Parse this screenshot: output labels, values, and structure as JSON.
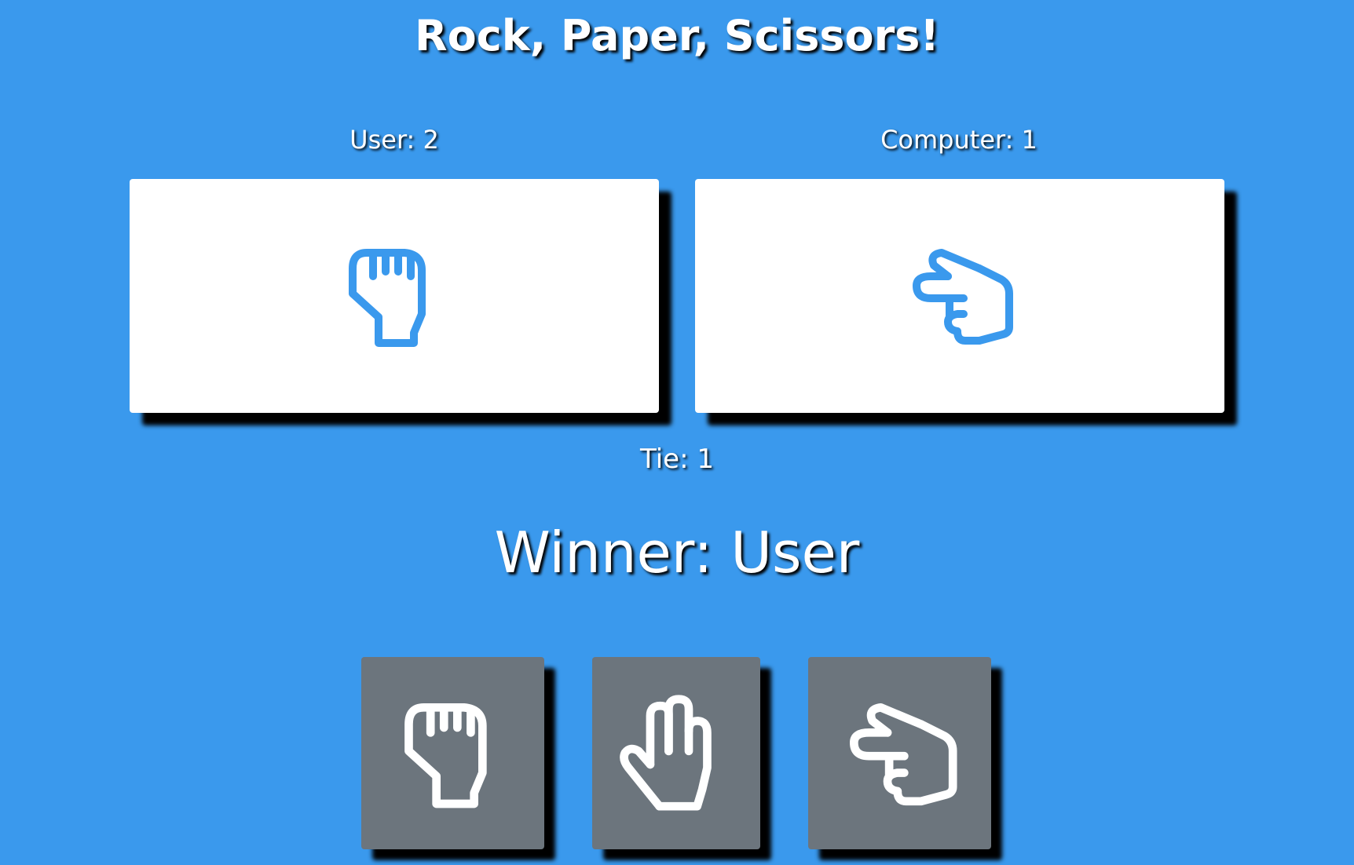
{
  "title": "Rock, Paper, Scissors!",
  "scores": {
    "user_label": "User: 2",
    "computer_label": "Computer: 1",
    "tie_label": "Tie: 1"
  },
  "result": {
    "user_choice_icon": "rock-icon",
    "computer_choice_icon": "scissors-icon",
    "winner_label": "Winner: User"
  },
  "choices": [
    {
      "id": "rock",
      "icon": "rock-icon"
    },
    {
      "id": "paper",
      "icon": "paper-icon"
    },
    {
      "id": "scissors",
      "icon": "scissors-icon"
    }
  ],
  "colors": {
    "background": "#3a99ed",
    "card": "#ffffff",
    "button": "#6c757d",
    "icon_on_card": "#3a99ed",
    "icon_on_button": "#ffffff"
  }
}
